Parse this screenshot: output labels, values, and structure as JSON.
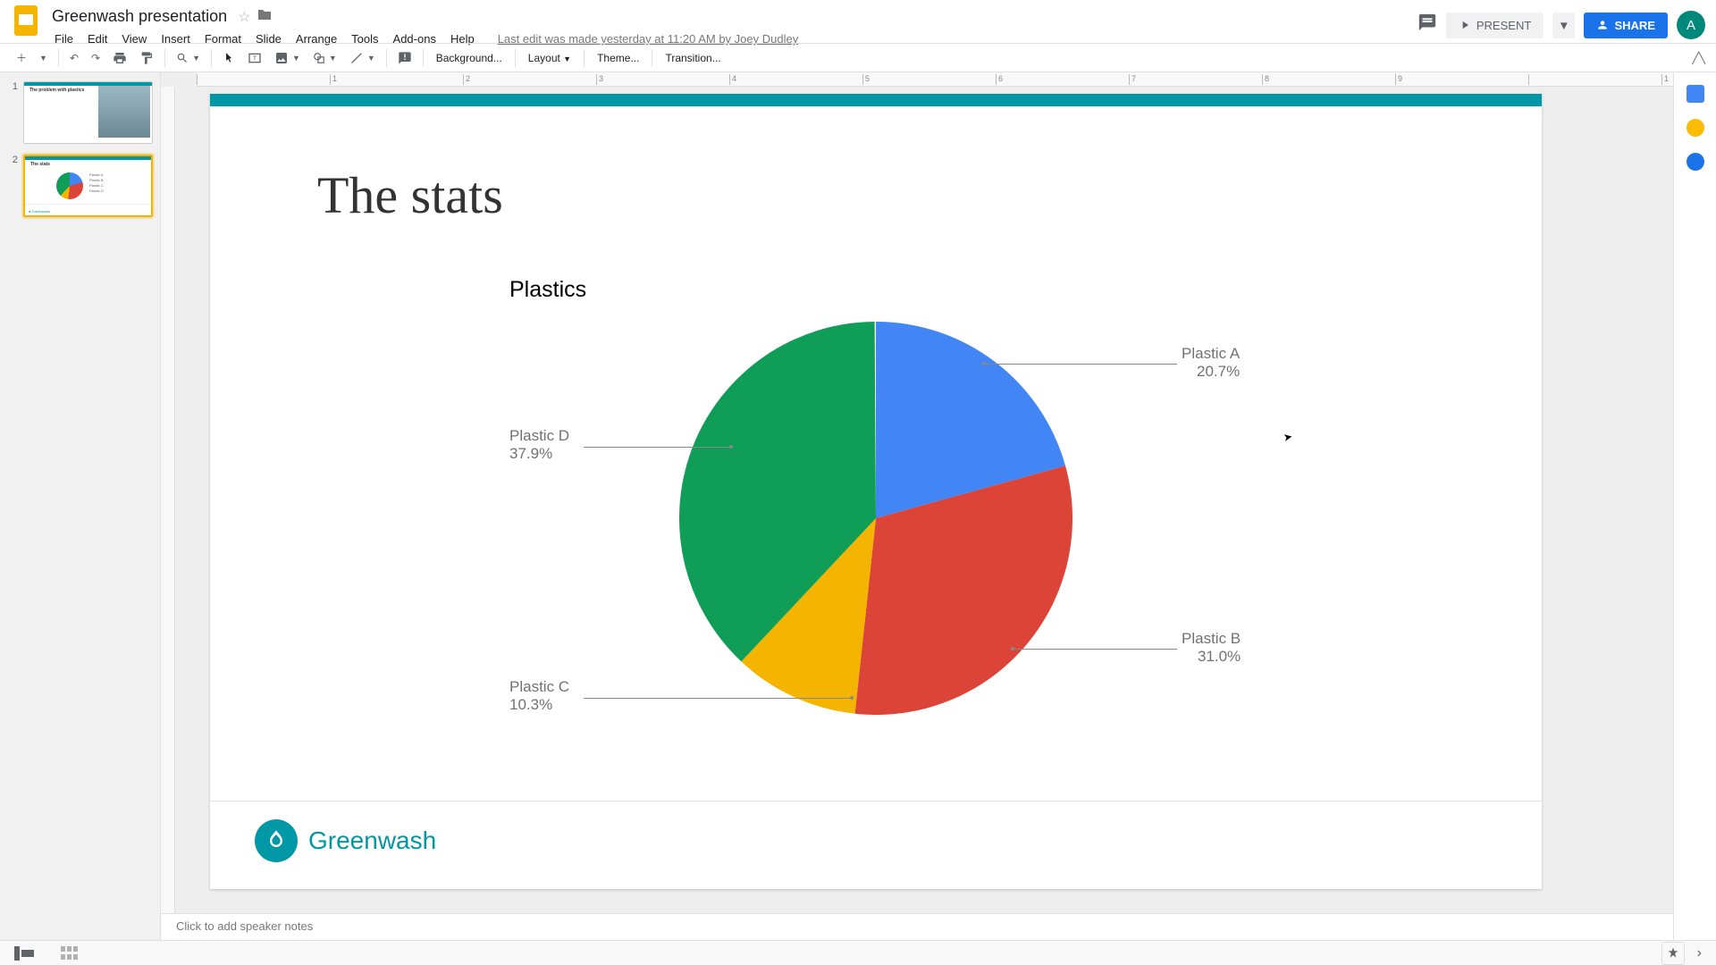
{
  "doc": {
    "title": "Greenwash presentation",
    "last_edit": "Last edit was made yesterday at 11:20 AM by Joey Dudley"
  },
  "menus": [
    "File",
    "Edit",
    "View",
    "Insert",
    "Format",
    "Slide",
    "Arrange",
    "Tools",
    "Add-ons",
    "Help"
  ],
  "header_buttons": {
    "present": "PRESENT",
    "share": "SHARE",
    "avatar_initial": "A"
  },
  "toolbar": {
    "background": "Background...",
    "layout": "Layout",
    "theme": "Theme...",
    "transition": "Transition..."
  },
  "thumbs": [
    {
      "num": "1",
      "title": "The problem with plastics"
    },
    {
      "num": "2",
      "title": "The stats"
    }
  ],
  "slide": {
    "title": "The stats",
    "chart_title": "Plastics",
    "brand": "Greenwash"
  },
  "chart_data": {
    "type": "pie",
    "title": "Plastics",
    "series": [
      {
        "name": "Plastic A",
        "value": 20.7,
        "percent_label": "20.7%",
        "color": "#4285f4"
      },
      {
        "name": "Plastic B",
        "value": 31.0,
        "percent_label": "31.0%",
        "color": "#db4437"
      },
      {
        "name": "Plastic C",
        "value": 10.3,
        "percent_label": "10.3%",
        "color": "#f4b400"
      },
      {
        "name": "Plastic D",
        "value": 37.9,
        "percent_label": "37.9%",
        "color": "#0f9d58"
      }
    ]
  },
  "notes": {
    "placeholder": "Click to add speaker notes"
  },
  "ruler_ticks": [
    "",
    "1",
    "2",
    "3",
    "4",
    "5",
    "6",
    "7",
    "8",
    "9",
    "",
    "1"
  ]
}
